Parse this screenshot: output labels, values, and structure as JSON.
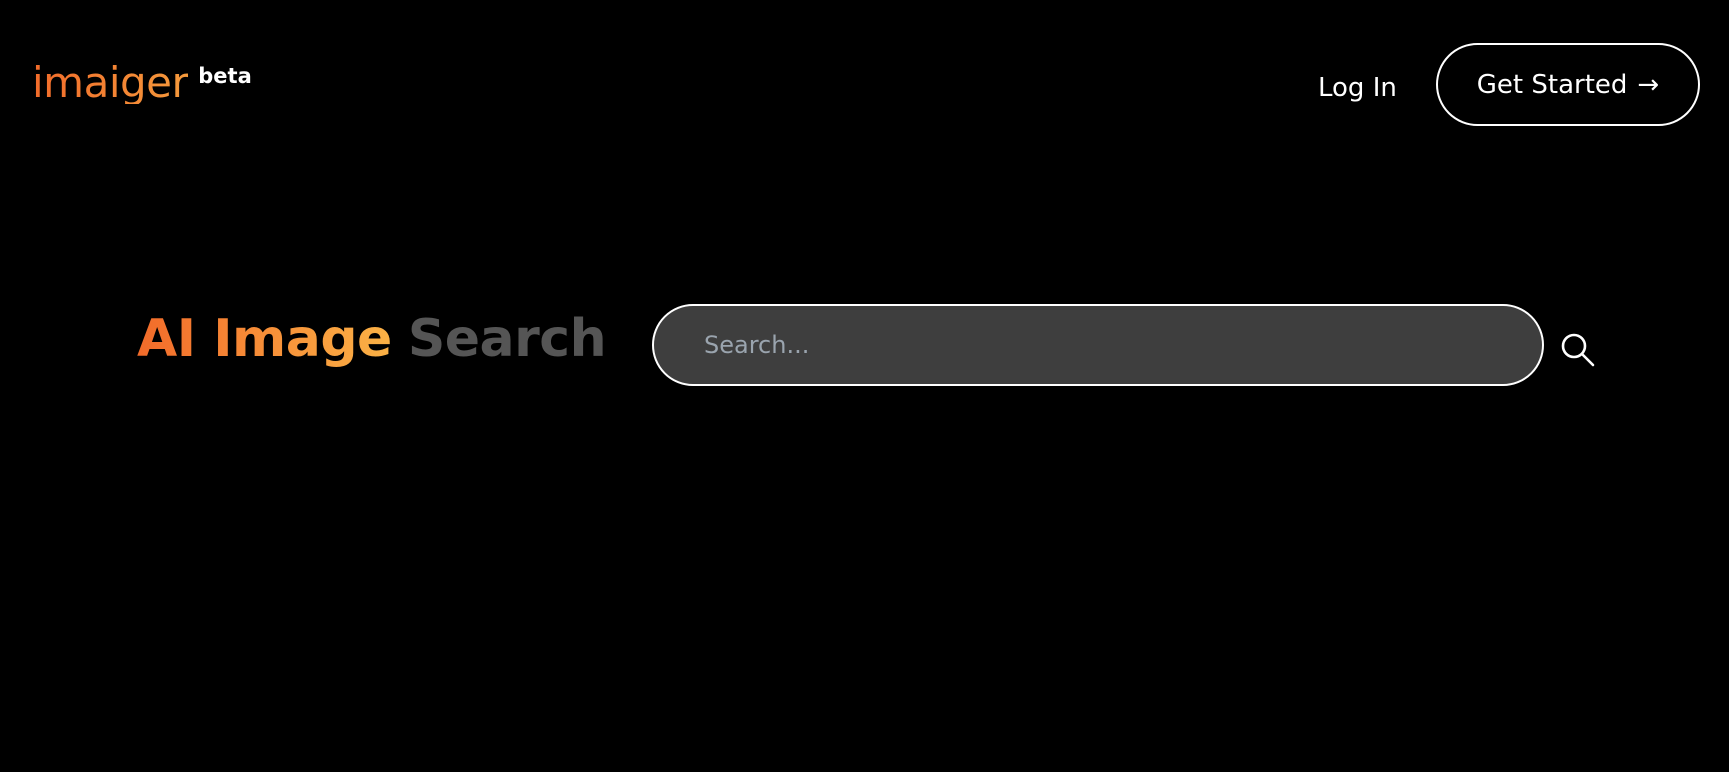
{
  "header": {
    "logo_text": "imaiger",
    "beta_label": "beta",
    "login_label": "Log In",
    "get_started_label": "Get Started",
    "get_started_arrow": "→"
  },
  "hero": {
    "title_accent": "AI Image",
    "title_muted": "Search"
  },
  "search": {
    "placeholder": "Search...",
    "value": "",
    "icon": "search-icon"
  },
  "colors": {
    "background": "#000000",
    "accent_start": "#f26b2a",
    "accent_end": "#fbb246",
    "muted_title": "#555555",
    "search_fill": "#3e3e3e",
    "placeholder": "#9aa4ae"
  }
}
